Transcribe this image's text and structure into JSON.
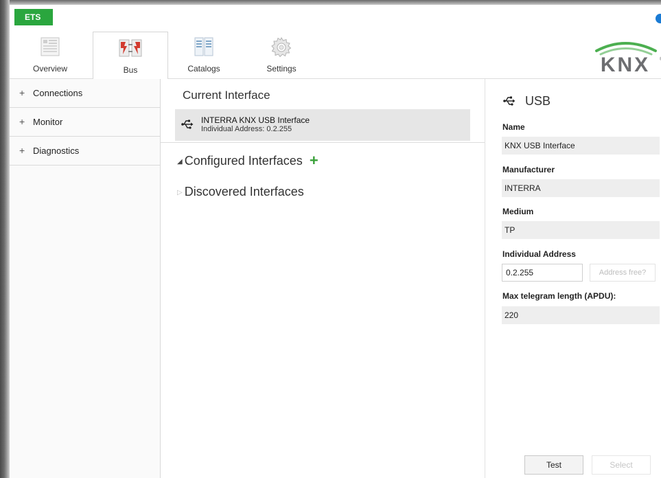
{
  "app": {
    "badge": "ETS"
  },
  "ribbon": {
    "tabs": [
      {
        "label": "Overview",
        "icon": "overview-icon"
      },
      {
        "label": "Bus",
        "icon": "bus-icon",
        "active": true
      },
      {
        "label": "Catalogs",
        "icon": "catalogs-icon"
      },
      {
        "label": "Settings",
        "icon": "gear-icon"
      }
    ],
    "logo": {
      "text": "KNX",
      "reg": "®"
    }
  },
  "sidebar": {
    "items": [
      {
        "label": "Connections"
      },
      {
        "label": "Monitor"
      },
      {
        "label": "Diagnostics"
      }
    ]
  },
  "center": {
    "current_title": "Current Interface",
    "current": {
      "name": "INTERRA KNX USB Interface",
      "address": "Individual Address: 0.2.255"
    },
    "configured_label": "Configured Interfaces",
    "discovered_label": "Discovered Interfaces"
  },
  "props": {
    "header": "USB",
    "name_label": "Name",
    "name_value": "KNX USB Interface",
    "manufacturer_label": "Manufacturer",
    "manufacturer_value": "INTERRA",
    "medium_label": "Medium",
    "medium_value": "TP",
    "individual_address_label": "Individual Address",
    "individual_address_value": "0.2.255",
    "address_free_label": "Address free?",
    "max_telegram_label": "Max telegram length (APDU):",
    "max_telegram_value": "220",
    "test_label": "Test",
    "select_label": "Select"
  },
  "colors": {
    "accent_green": "#2aa63e",
    "knx_green": "#4caf50",
    "knx_text": "#6d6e71",
    "add_plus": "#3aa13a"
  }
}
